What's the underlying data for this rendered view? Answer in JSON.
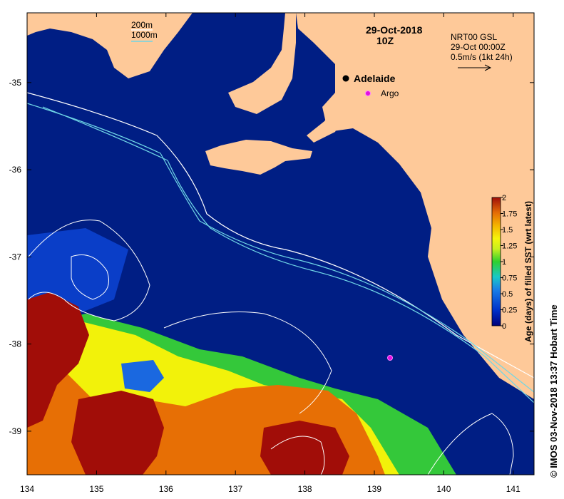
{
  "map": {
    "date": "29-Oct-2018",
    "time": "10Z",
    "lon_ticks": [
      "134",
      "135",
      "136",
      "137",
      "138",
      "139",
      "140",
      "141"
    ],
    "lat_ticks": [
      "-35",
      "-36",
      "-37",
      "-38",
      "-39"
    ],
    "lon_range": [
      134,
      141.3
    ],
    "lat_range": [
      -39.5,
      -34.2
    ]
  },
  "bathy_legend": {
    "contour_200": "200m",
    "contour_1000": "1000m",
    "color_200": "#ffffff",
    "color_1000": "#6fd6e6"
  },
  "current_legend": {
    "line1": "NRT00 GSL",
    "line2": "29-Oct 00:00Z",
    "line3": "0.5m/s (1kt 24h)"
  },
  "places": [
    {
      "name": "Adelaide",
      "lon": 138.6,
      "lat": -34.93
    },
    {
      "name": "Argo",
      "lon": 138.88,
      "lat": -35.12
    }
  ],
  "argo_float": {
    "lon": 139.2,
    "lat": -38.16
  },
  "colorbar": {
    "title": "Age (days) of filled SST (wrt latest)",
    "ticks": [
      "2",
      "1.75",
      "1.5",
      "1.25",
      "1",
      "0.75",
      "0.5",
      "0.25",
      "0"
    ],
    "range": [
      0,
      2
    ]
  },
  "credit": "© IMOS 03-Nov-2018 13:37 Hobart Time",
  "colors": {
    "ocean": "#001e84",
    "land": "#fec999",
    "age_mid": "#f2f20a",
    "age_high": "#a00d08"
  }
}
